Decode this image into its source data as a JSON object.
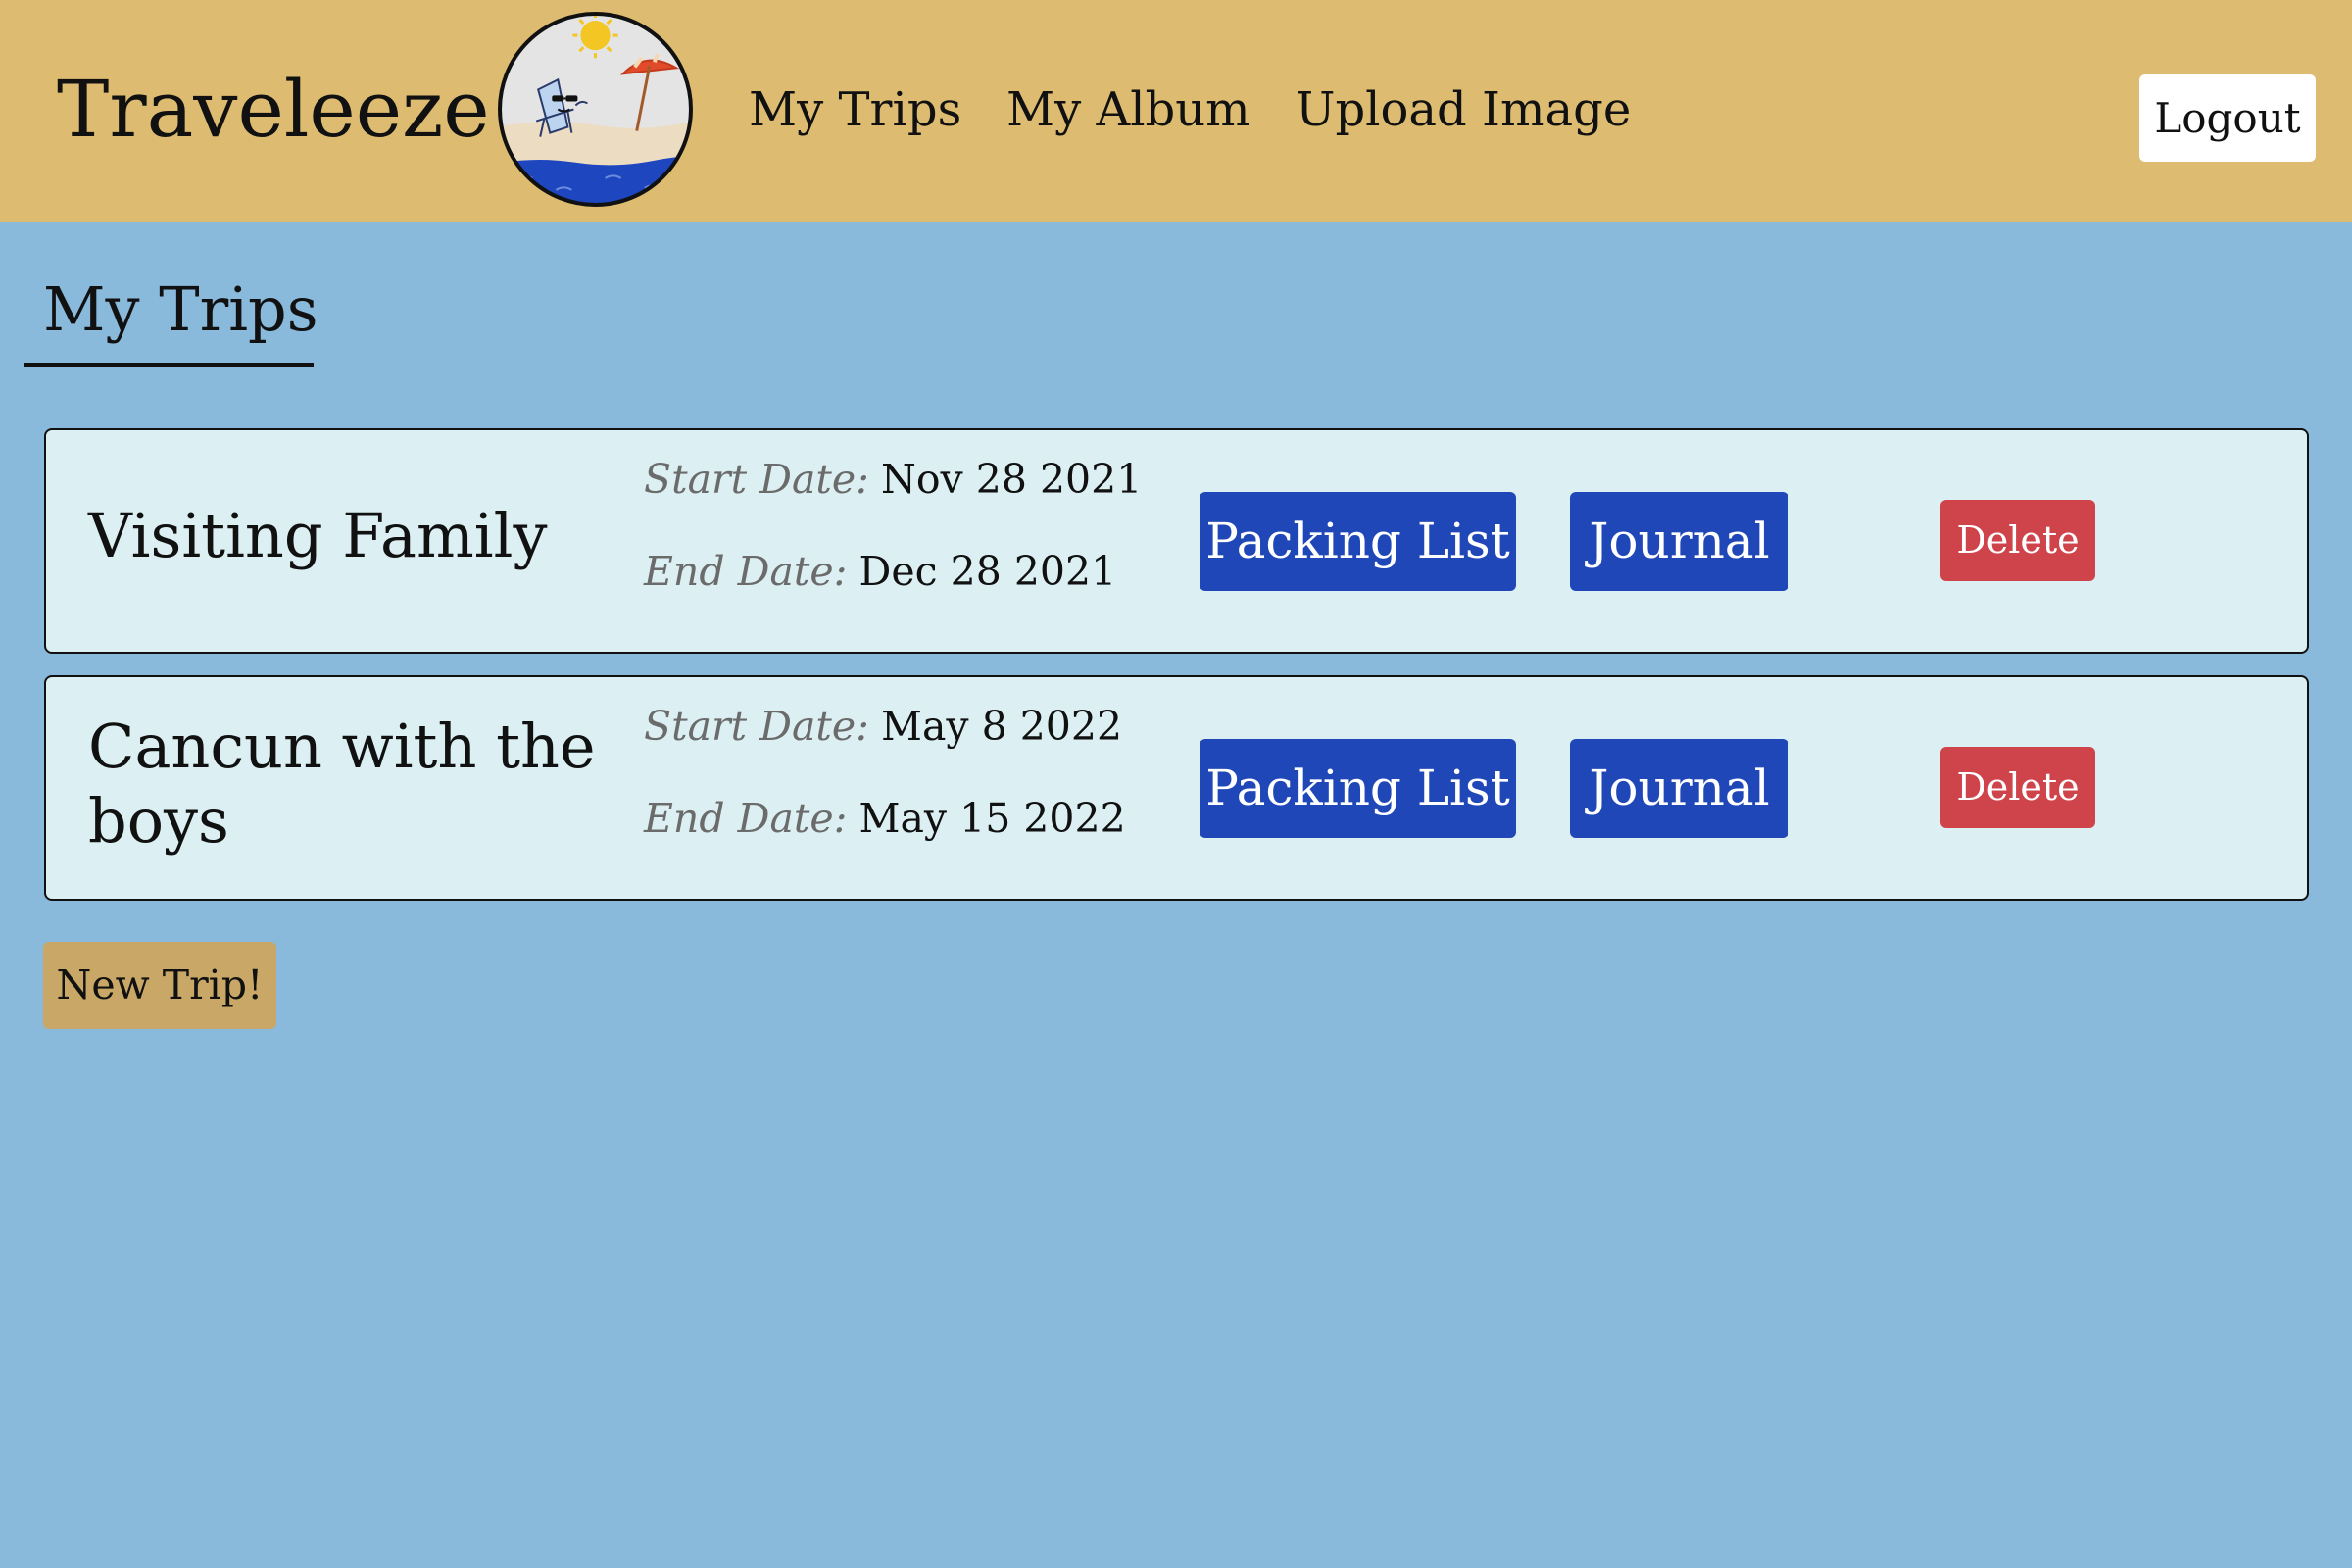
{
  "header": {
    "brand": "Traveleeze",
    "logo_icon": "beach-logo-icon",
    "nav": [
      "My Trips",
      "My Album",
      "Upload Image"
    ],
    "logout_label": "Logout",
    "background": "#ddbc71"
  },
  "page": {
    "title": "My Trips",
    "background": "#89b9db"
  },
  "trips": [
    {
      "name": "Visiting Family",
      "start_label": "Start Date:",
      "start_date": "Nov 28 2021",
      "end_label": "End Date:",
      "end_date": "Dec 28 2021",
      "packing_label": "Packing List",
      "journal_label": "Journal",
      "delete_label": "Delete"
    },
    {
      "name": "Cancun with the boys",
      "start_label": "Start Date:",
      "start_date": "May 8 2022",
      "end_label": "End Date:",
      "end_date": "May 15 2022",
      "packing_label": "Packing List",
      "journal_label": "Journal",
      "delete_label": "Delete"
    }
  ],
  "new_trip_label": "New Trip!",
  "colors": {
    "primary_button": "#1f47b8",
    "delete_button": "#cf434b",
    "new_trip_button": "#c9a867",
    "card_background": "#dcf0f3"
  }
}
